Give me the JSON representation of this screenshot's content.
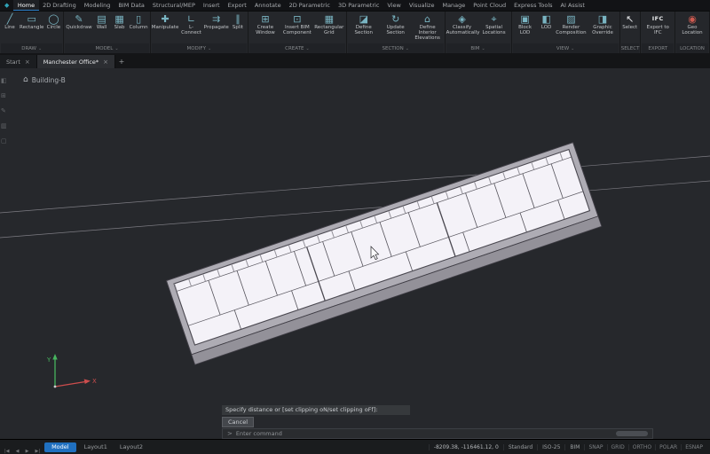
{
  "app": {
    "logo_glyph": "◆",
    "accent": "#2f81c9",
    "canvas_bg": "#26282c"
  },
  "menu": {
    "items": [
      {
        "label": "Home"
      },
      {
        "label": "2D Drafting"
      },
      {
        "label": "Modeling"
      },
      {
        "label": "BIM Data"
      },
      {
        "label": "Structural/MEP"
      },
      {
        "label": "Insert"
      },
      {
        "label": "Export"
      },
      {
        "label": "Annotate"
      },
      {
        "label": "2D Parametric"
      },
      {
        "label": "3D Parametric"
      },
      {
        "label": "View"
      },
      {
        "label": "Visualize"
      },
      {
        "label": "Manage"
      },
      {
        "label": "Point Cloud"
      },
      {
        "label": "Express Tools"
      },
      {
        "label": "AI Assist"
      }
    ]
  },
  "ribbon": {
    "chevron": "⌄",
    "groups": [
      {
        "label": "DRAW",
        "tools": [
          {
            "label": "Line",
            "glyph": "╱"
          },
          {
            "label": "Rectangle",
            "glyph": "▭"
          },
          {
            "label": "Circle",
            "glyph": "◯"
          }
        ]
      },
      {
        "label": "MODEL",
        "tools": [
          {
            "label": "Quickdraw",
            "glyph": "✎"
          },
          {
            "label": "Wall",
            "glyph": "▤"
          },
          {
            "label": "Slab",
            "glyph": "▦"
          },
          {
            "label": "Column",
            "glyph": "▯"
          }
        ]
      },
      {
        "label": "MODIFY",
        "tools": [
          {
            "label": "Manipulate",
            "glyph": "✚"
          },
          {
            "label": "L-Connect",
            "glyph": "∟"
          },
          {
            "label": "Propagate",
            "glyph": "⇉"
          },
          {
            "label": "Split",
            "glyph": "∥"
          }
        ]
      },
      {
        "label": "CREATE",
        "tools": [
          {
            "label": "Create Window",
            "glyph": "⊞"
          },
          {
            "label": "Insert BIM Component",
            "glyph": "⊡"
          },
          {
            "label": "Rectangular Grid",
            "glyph": "▦"
          }
        ]
      },
      {
        "label": "SECTION",
        "tools": [
          {
            "label": "Define Section",
            "glyph": "◪"
          },
          {
            "label": "Update Section",
            "glyph": "↻"
          },
          {
            "label": "Define Interior Elevations",
            "glyph": "⌂"
          }
        ]
      },
      {
        "label": "BIM",
        "tools": [
          {
            "label": "Classify Automatically",
            "glyph": "◈"
          },
          {
            "label": "Spatial Locations",
            "glyph": "⌖"
          }
        ]
      },
      {
        "label": "VIEW",
        "tools": [
          {
            "label": "Block LOD",
            "glyph": "▣"
          },
          {
            "label": "LOD",
            "glyph": "◧"
          },
          {
            "label": "Render Composition",
            "glyph": "▨"
          },
          {
            "label": "Graphic Override",
            "glyph": "◨"
          }
        ]
      },
      {
        "label": "SELECT",
        "tools": [
          {
            "label": "Select",
            "glyph": "↖"
          }
        ]
      },
      {
        "label": "EXPORT",
        "tools": [
          {
            "label": "Export to IFC",
            "glyph": "IFC"
          }
        ]
      },
      {
        "label": "LOCATION",
        "tools": [
          {
            "label": "Geo Location",
            "glyph": "◉"
          }
        ]
      }
    ]
  },
  "tabs": {
    "items": [
      {
        "label": "Start"
      },
      {
        "label": "Manchester Office*"
      }
    ],
    "close_glyph": "×",
    "new_tab_glyph": "+"
  },
  "canvas": {
    "breadcrumb": {
      "icon": "⌂",
      "label": "Building-B"
    },
    "ucs": {
      "x_label": "X",
      "y_label": "Y"
    }
  },
  "left_toolbar": {
    "icons": [
      {
        "glyph": "◧"
      },
      {
        "glyph": "⊞"
      },
      {
        "glyph": "✎"
      },
      {
        "glyph": "▥"
      },
      {
        "glyph": "▢"
      }
    ]
  },
  "command": {
    "history": "Specify distance or [set clipping oN/set clipping oFf]:",
    "cancel_label": "Cancel",
    "prompt_glyph": ">",
    "placeholder": "Enter command"
  },
  "statusbar": {
    "nav": [
      "|◀",
      "◀",
      "▶",
      "▶|"
    ],
    "model_tab": "Model",
    "layout_tabs": [
      "Layout1",
      "Layout2"
    ],
    "coordinates": "-8209.38, -116461.12, 0",
    "fields": [
      "Standard",
      "ISO-25",
      "BIM"
    ],
    "toggles": [
      "SNAP",
      "GRID",
      "ORTHO",
      "POLAR",
      "ESNAP"
    ]
  }
}
